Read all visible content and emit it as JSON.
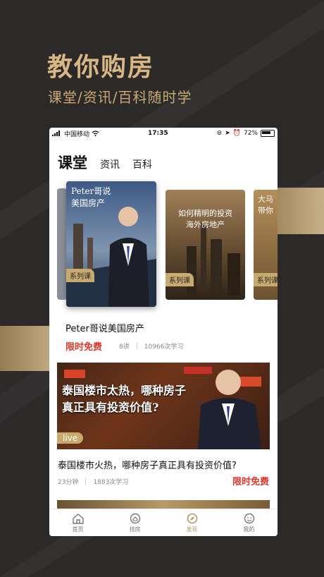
{
  "hero": {
    "title": "教你购房",
    "subtitle": "课堂/资讯/百科随时学"
  },
  "status_bar": {
    "carrier": "中国移动",
    "time": "17:35",
    "battery": "72%"
  },
  "tabs": [
    {
      "label": "课堂",
      "active": true
    },
    {
      "label": "资讯",
      "active": false
    },
    {
      "label": "百科",
      "active": false
    }
  ],
  "carousel": [
    {
      "title_line1": "Peter哥说",
      "title_line2": "美国房产",
      "tag": "系列课"
    },
    {
      "title_line1": "如何精明的投资",
      "title_line2": "海外房地产",
      "tag": "系列课"
    },
    {
      "title_line1": "大马",
      "title_line2": "带你",
      "tag": "系列课"
    }
  ],
  "course": {
    "title": "Peter哥说美国房产",
    "price": "限时免费",
    "lessons": "8讲",
    "learners": "10966次学习"
  },
  "live": {
    "banner_line1": "泰国楼市太热，哪种房子",
    "banner_line2": "真正具有投资价值?",
    "badge": "live",
    "title": "泰国楼市火热，哪种房子真正具有投资价值?",
    "duration": "23分钟",
    "learners": "1883次学习",
    "price": "限时免费"
  },
  "tabbar": [
    {
      "label": "首页",
      "icon": "home-icon",
      "active": false
    },
    {
      "label": "找房",
      "icon": "search-house-icon",
      "active": false
    },
    {
      "label": "发现",
      "icon": "discover-icon",
      "active": true
    },
    {
      "label": "我的",
      "icon": "profile-icon",
      "active": false
    }
  ],
  "colors": {
    "gold": "#d9b784",
    "accent_red": "#e5352b",
    "tab_active": "#b8955e"
  }
}
